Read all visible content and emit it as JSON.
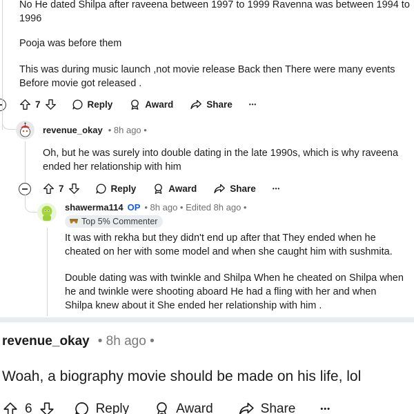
{
  "top_comment": {
    "lines": [
      "No He dated Shilpa after raveena between 1997 to 1999 Ravenna was between 1994 to",
      "1996",
      "Pooja was before them",
      "This was during music launch ,not movie release Back then There were many events",
      "Before movie got released ."
    ],
    "votes": "7",
    "reply": "Reply",
    "award": "Award",
    "share": "Share",
    "more": "•••"
  },
  "reply1": {
    "author": "revenue_okay",
    "time": "• 8h ago •",
    "lines": [
      "Oh, but he was surely into double dating in the late 1990s, which is why raveena",
      "ended her relationship with him"
    ],
    "votes": "7",
    "reply": "Reply",
    "award": "Award",
    "share": "Share",
    "more": "•••"
  },
  "reply2": {
    "author": "shawerma114",
    "op": "OP",
    "time": "• 8h ago • Edited 8h ago •",
    "badge": "Top 5% Commenter",
    "lines": [
      "It was with rekha but they didn't end up after that They ended when he",
      "cheated on her with some model and when she caught him with sushmita.",
      "Double dating was with twinkle and Shilpa When he cheated on Shilpa when",
      "he and twinkle were shooting aboard He had a fling with her and when",
      "Shilpa knew about it She ended her relationship with him ."
    ]
  },
  "bottom_comment": {
    "author": "revenue_okay",
    "time": "• 8h ago •",
    "text": "Woah, a biography movie should be made on his life, lol",
    "votes": "6",
    "reply": "Reply",
    "award": "Award",
    "share": "Share",
    "more": "•••"
  },
  "icons": {
    "upvote": "upvote-icon",
    "downvote": "downvote-icon",
    "reply": "comment-bubble-icon",
    "award": "award-icon",
    "share": "share-arrow-icon",
    "collapse": "collapse-minus-icon"
  },
  "colors": {
    "op": "#0f5cd6",
    "meta": "#707070",
    "separator": "#e9ecef",
    "badge_bg": "#eaedef"
  }
}
